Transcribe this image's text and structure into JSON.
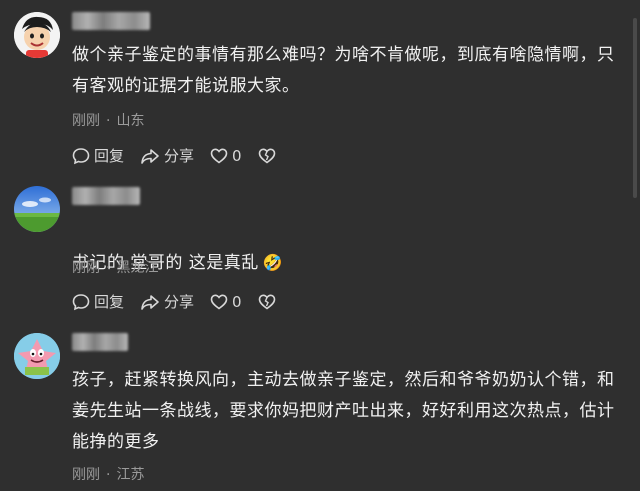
{
  "comments": [
    {
      "avatar_icon": "cartoon-boy-avatar-icon",
      "text": "做个亲子鉴定的事情有那么难吗？为啥不肯做呢，到底有啥隐情啊，只有客观的证据才能说服大家。",
      "time": "刚刚",
      "location": "山东",
      "actions": {
        "reply": "回复",
        "share": "分享",
        "likes": "0"
      }
    },
    {
      "avatar_icon": "landscape-avatar-icon",
      "text": "书记的 堂哥的 这是真乱",
      "emoji": "🤣",
      "time": "刚刚",
      "location": "黑龙江",
      "actions": {
        "reply": "回复",
        "share": "分享",
        "likes": "0"
      }
    },
    {
      "avatar_icon": "patrick-star-avatar-icon",
      "text": "孩子，赶紧转换风向，主动去做亲子鉴定，然后和爷爷奶奶认个错，和姜先生站一条战线，要求你妈把财产吐出来，好好利用这次热点，估计能挣的更多",
      "time": "刚刚",
      "location": "江苏"
    }
  ]
}
